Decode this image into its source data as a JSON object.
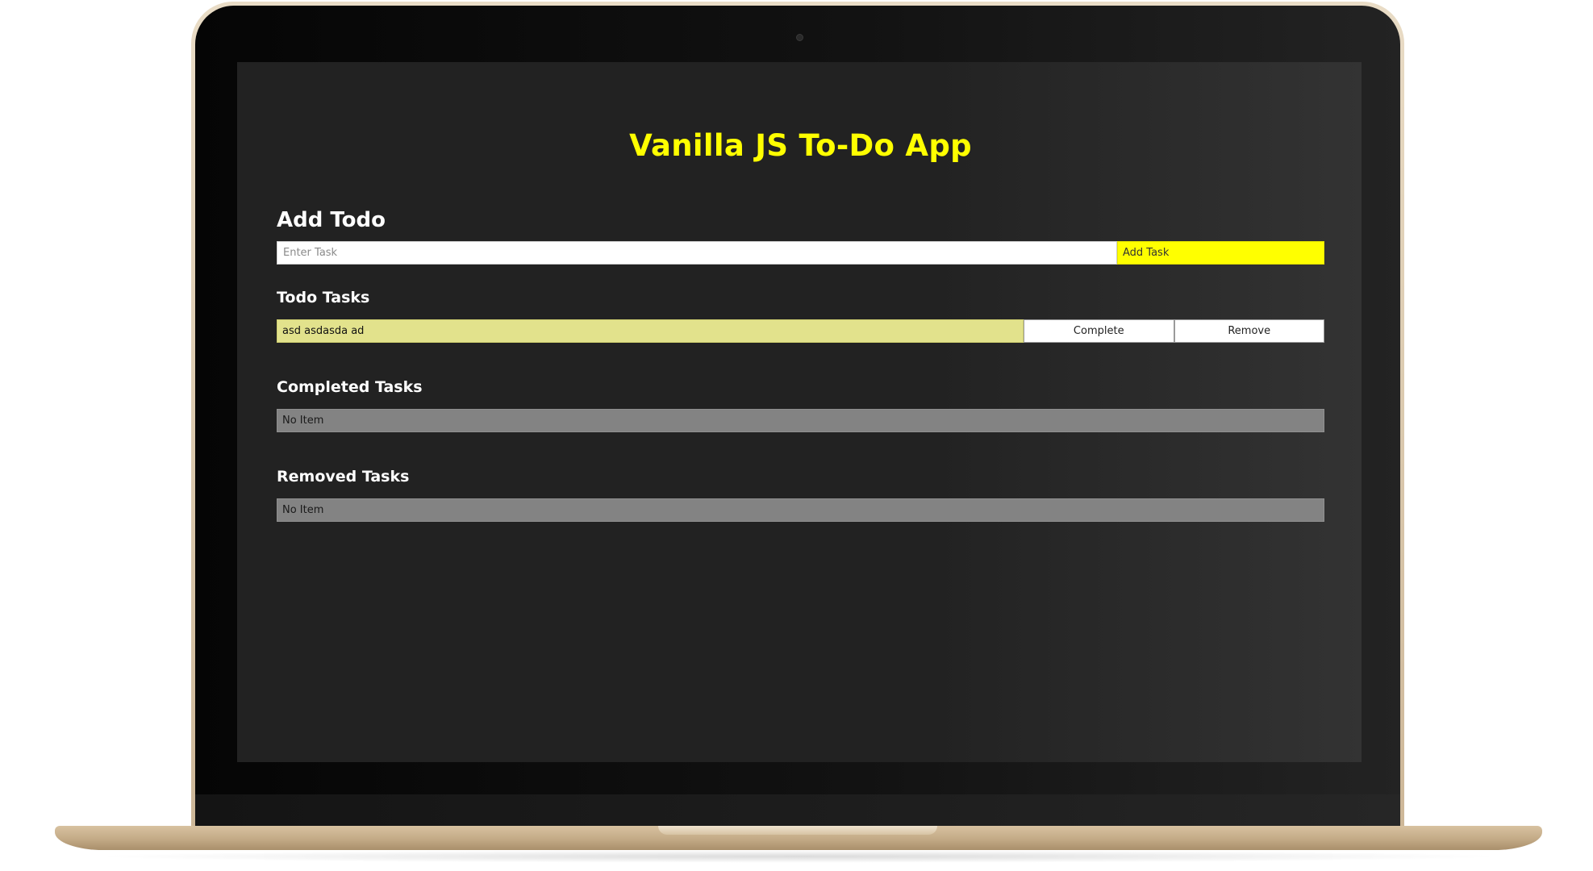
{
  "app": {
    "title": "Vanilla JS To-Do App"
  },
  "add_todo": {
    "heading": "Add Todo",
    "input_value": "",
    "input_placeholder": "Enter Task",
    "button_label": "Add Task"
  },
  "todo_tasks": {
    "heading": "Todo Tasks",
    "items": [
      {
        "text": "asd asdasda ad",
        "complete_label": "Complete",
        "remove_label": "Remove"
      }
    ]
  },
  "completed_tasks": {
    "heading": "Completed Tasks",
    "empty_text": "No Item"
  },
  "removed_tasks": {
    "heading": "Removed Tasks",
    "empty_text": "No Item"
  },
  "colors": {
    "accent": "#ffff00",
    "todo_item_bg": "#e2e28c",
    "empty_item_bg": "#838383",
    "screen_bg": "#222222"
  }
}
